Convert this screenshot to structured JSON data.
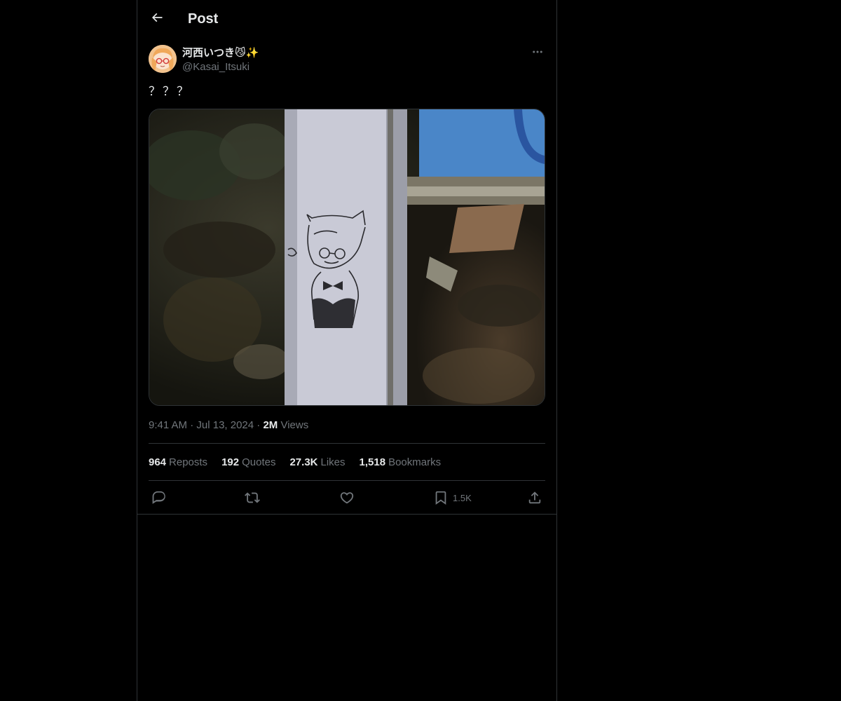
{
  "header": {
    "title": "Post"
  },
  "post": {
    "author": {
      "display_name": "河西いつき",
      "display_name_emoji": "😼✨",
      "handle": "@Kasai_Itsuki"
    },
    "text": "？？？",
    "time": "9:41 AM",
    "date": "Jul 13, 2024",
    "views_count": "2M",
    "views_label": "Views",
    "stats": {
      "reposts_count": "964",
      "reposts_label": "Reposts",
      "quotes_count": "192",
      "quotes_label": "Quotes",
      "likes_count": "27.3K",
      "likes_label": "Likes",
      "bookmarks_count": "1,518",
      "bookmarks_label": "Bookmarks"
    },
    "actions": {
      "bookmark_count": "1.5K"
    }
  },
  "colors": {
    "background": "#000000",
    "text": "#e7e9ea",
    "secondary_text": "#71767b",
    "border": "#2f3336"
  }
}
